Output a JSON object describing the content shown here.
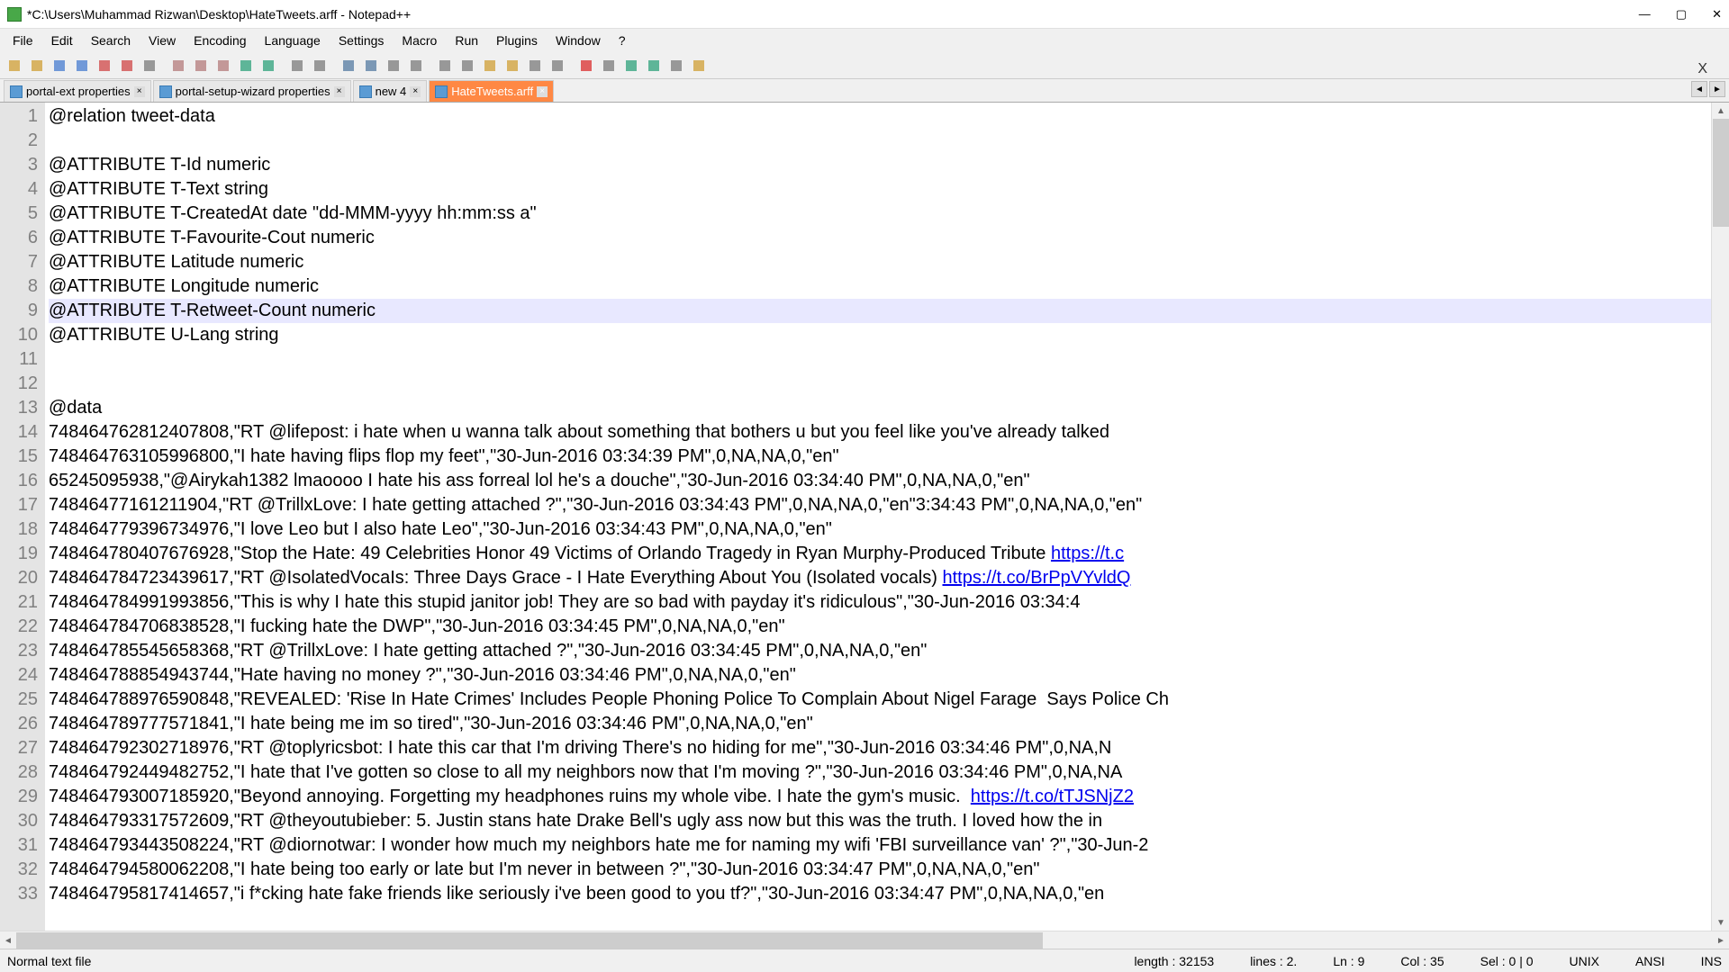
{
  "window": {
    "title": "*C:\\Users\\Muhammad Rizwan\\Desktop\\HateTweets.arff - Notepad++"
  },
  "menu": {
    "items": [
      "File",
      "Edit",
      "Search",
      "View",
      "Encoding",
      "Language",
      "Settings",
      "Macro",
      "Run",
      "Plugins",
      "Window",
      "?"
    ]
  },
  "tabs": [
    {
      "label": "portal-ext properties",
      "active": false,
      "highlighted": false
    },
    {
      "label": "portal-setup-wizard properties",
      "active": false,
      "highlighted": false
    },
    {
      "label": "new 4",
      "active": false,
      "highlighted": false
    },
    {
      "label": "HateTweets.arff",
      "active": true,
      "highlighted": true
    }
  ],
  "editor": {
    "current_line": 9,
    "lines": [
      {
        "n": 1,
        "text": "@relation tweet-data"
      },
      {
        "n": 2,
        "text": ""
      },
      {
        "n": 3,
        "text": "@ATTRIBUTE T-Id numeric"
      },
      {
        "n": 4,
        "text": "@ATTRIBUTE T-Text string"
      },
      {
        "n": 5,
        "text": "@ATTRIBUTE T-CreatedAt date \"dd-MMM-yyyy hh:mm:ss a\""
      },
      {
        "n": 6,
        "text": "@ATTRIBUTE T-Favourite-Cout numeric"
      },
      {
        "n": 7,
        "text": "@ATTRIBUTE Latitude numeric"
      },
      {
        "n": 8,
        "text": "@ATTRIBUTE Longitude numeric"
      },
      {
        "n": 9,
        "text": "@ATTRIBUTE T-Retweet-Count numeric"
      },
      {
        "n": 10,
        "text": "@ATTRIBUTE U-Lang string"
      },
      {
        "n": 11,
        "text": ""
      },
      {
        "n": 12,
        "text": ""
      },
      {
        "n": 13,
        "text": "@data"
      },
      {
        "n": 14,
        "text": "748464762812407808,\"RT @lifepost: i hate when u wanna talk about something that bothers u but you feel like you've already talked"
      },
      {
        "n": 15,
        "text": "748464763105996800,\"I hate having flips flop my feet\",\"30-Jun-2016 03:34:39 PM\",0,NA,NA,0,\"en\""
      },
      {
        "n": 16,
        "text": "65245095938,\"@Airykah1382 lmaoooo I hate his ass forreal lol he's a douche\",\"30-Jun-2016 03:34:40 PM\",0,NA,NA,0,\"en\""
      },
      {
        "n": 17,
        "text": "74846477161211904,\"RT @TrillxLove: I hate getting attached ?\",\"30-Jun-2016 03:34:43 PM\",0,NA,NA,0,\"en\"3:34:43 PM\",0,NA,NA,0,\"en\""
      },
      {
        "n": 18,
        "text": "748464779396734976,\"I love Leo but I also hate Leo\",\"30-Jun-2016 03:34:43 PM\",0,NA,NA,0,\"en\""
      },
      {
        "n": 19,
        "text": "748464780407676928,\"Stop the Hate: 49 Celebrities Honor 49 Victims of Orlando Tragedy in Ryan Murphy-Produced Tribute ",
        "link": "https://t.c"
      },
      {
        "n": 20,
        "text": "748464784723439617,\"RT @IsolatedVocaIs: Three Days Grace - I Hate Everything About You (Isolated vocals) ",
        "link": "https://t.co/BrPpVYvldQ"
      },
      {
        "n": 21,
        "text": "748464784991993856,\"This is why I hate this stupid janitor job! They are so bad with payday it's ridiculous\",\"30-Jun-2016 03:34:4"
      },
      {
        "n": 22,
        "text": "748464784706838528,\"I fucking hate the DWP\",\"30-Jun-2016 03:34:45 PM\",0,NA,NA,0,\"en\""
      },
      {
        "n": 23,
        "text": "748464785545658368,\"RT @TrillxLove: I hate getting attached ?\",\"30-Jun-2016 03:34:45 PM\",0,NA,NA,0,\"en\""
      },
      {
        "n": 24,
        "text": "748464788854943744,\"Hate having no money ?\",\"30-Jun-2016 03:34:46 PM\",0,NA,NA,0,\"en\""
      },
      {
        "n": 25,
        "text": "748464788976590848,\"REVEALED: 'Rise In Hate Crimes' Includes People Phoning Police To Complain About Nigel Farage  Says Police Ch"
      },
      {
        "n": 26,
        "text": "748464789777571841,\"I hate being me im so tired\",\"30-Jun-2016 03:34:46 PM\",0,NA,NA,0,\"en\""
      },
      {
        "n": 27,
        "text": "748464792302718976,\"RT @toplyricsbot: I hate this car that I'm driving There's no hiding for me\",\"30-Jun-2016 03:34:46 PM\",0,NA,N"
      },
      {
        "n": 28,
        "text": "748464792449482752,\"I hate that I've gotten so close to all my neighbors now that I'm moving ?\",\"30-Jun-2016 03:34:46 PM\",0,NA,NA"
      },
      {
        "n": 29,
        "text": "748464793007185920,\"Beyond annoying. Forgetting my headphones ruins my whole vibe. I hate the gym's music.  ",
        "link": "https://t.co/tTJSNjZ2"
      },
      {
        "n": 30,
        "text": "748464793317572609,\"RT @theyoutubieber: 5. Justin stans hate Drake Bell's ugly ass now but this was the truth. I loved how the in"
      },
      {
        "n": 31,
        "text": "748464793443508224,\"RT @diornotwar: I wonder how much my neighbors hate me for naming my wifi 'FBI surveillance van' ?\",\"30-Jun-2"
      },
      {
        "n": 32,
        "text": "748464794580062208,\"I hate being too early or late but I'm never in between ?\",\"30-Jun-2016 03:34:47 PM\",0,NA,NA,0,\"en\""
      },
      {
        "n": 33,
        "text": "748464795817414657,\"i f*cking hate fake friends like seriously i've been good to you tf?\",\"30-Jun-2016 03:34:47 PM\",0,NA,NA,0,\"en"
      }
    ]
  },
  "status": {
    "filetype": "Normal text file",
    "length": "length : 32153",
    "lines": "lines : 2.",
    "ln": "Ln : 9",
    "col": "Col : 35",
    "sel": "Sel : 0 | 0",
    "eol": "UNIX",
    "encoding": "ANSI",
    "mode": "INS"
  },
  "toolbar_icons": [
    "new-file-icon",
    "open-file-icon",
    "save-icon",
    "save-all-icon",
    "close-icon",
    "close-all-icon",
    "print-icon",
    "cut-icon",
    "copy-icon",
    "paste-icon",
    "undo-icon",
    "redo-icon",
    "find-icon",
    "replace-icon",
    "zoom-in-icon",
    "zoom-out-icon",
    "sync-v-icon",
    "sync-h-icon",
    "wrap-icon",
    "show-all-icon",
    "indent-guide-icon",
    "folder-icon",
    "doc-map-icon",
    "func-list-icon",
    "record-icon",
    "stop-icon",
    "play-icon",
    "play-multi-icon",
    "save-macro-icon",
    "spacer-icon"
  ]
}
